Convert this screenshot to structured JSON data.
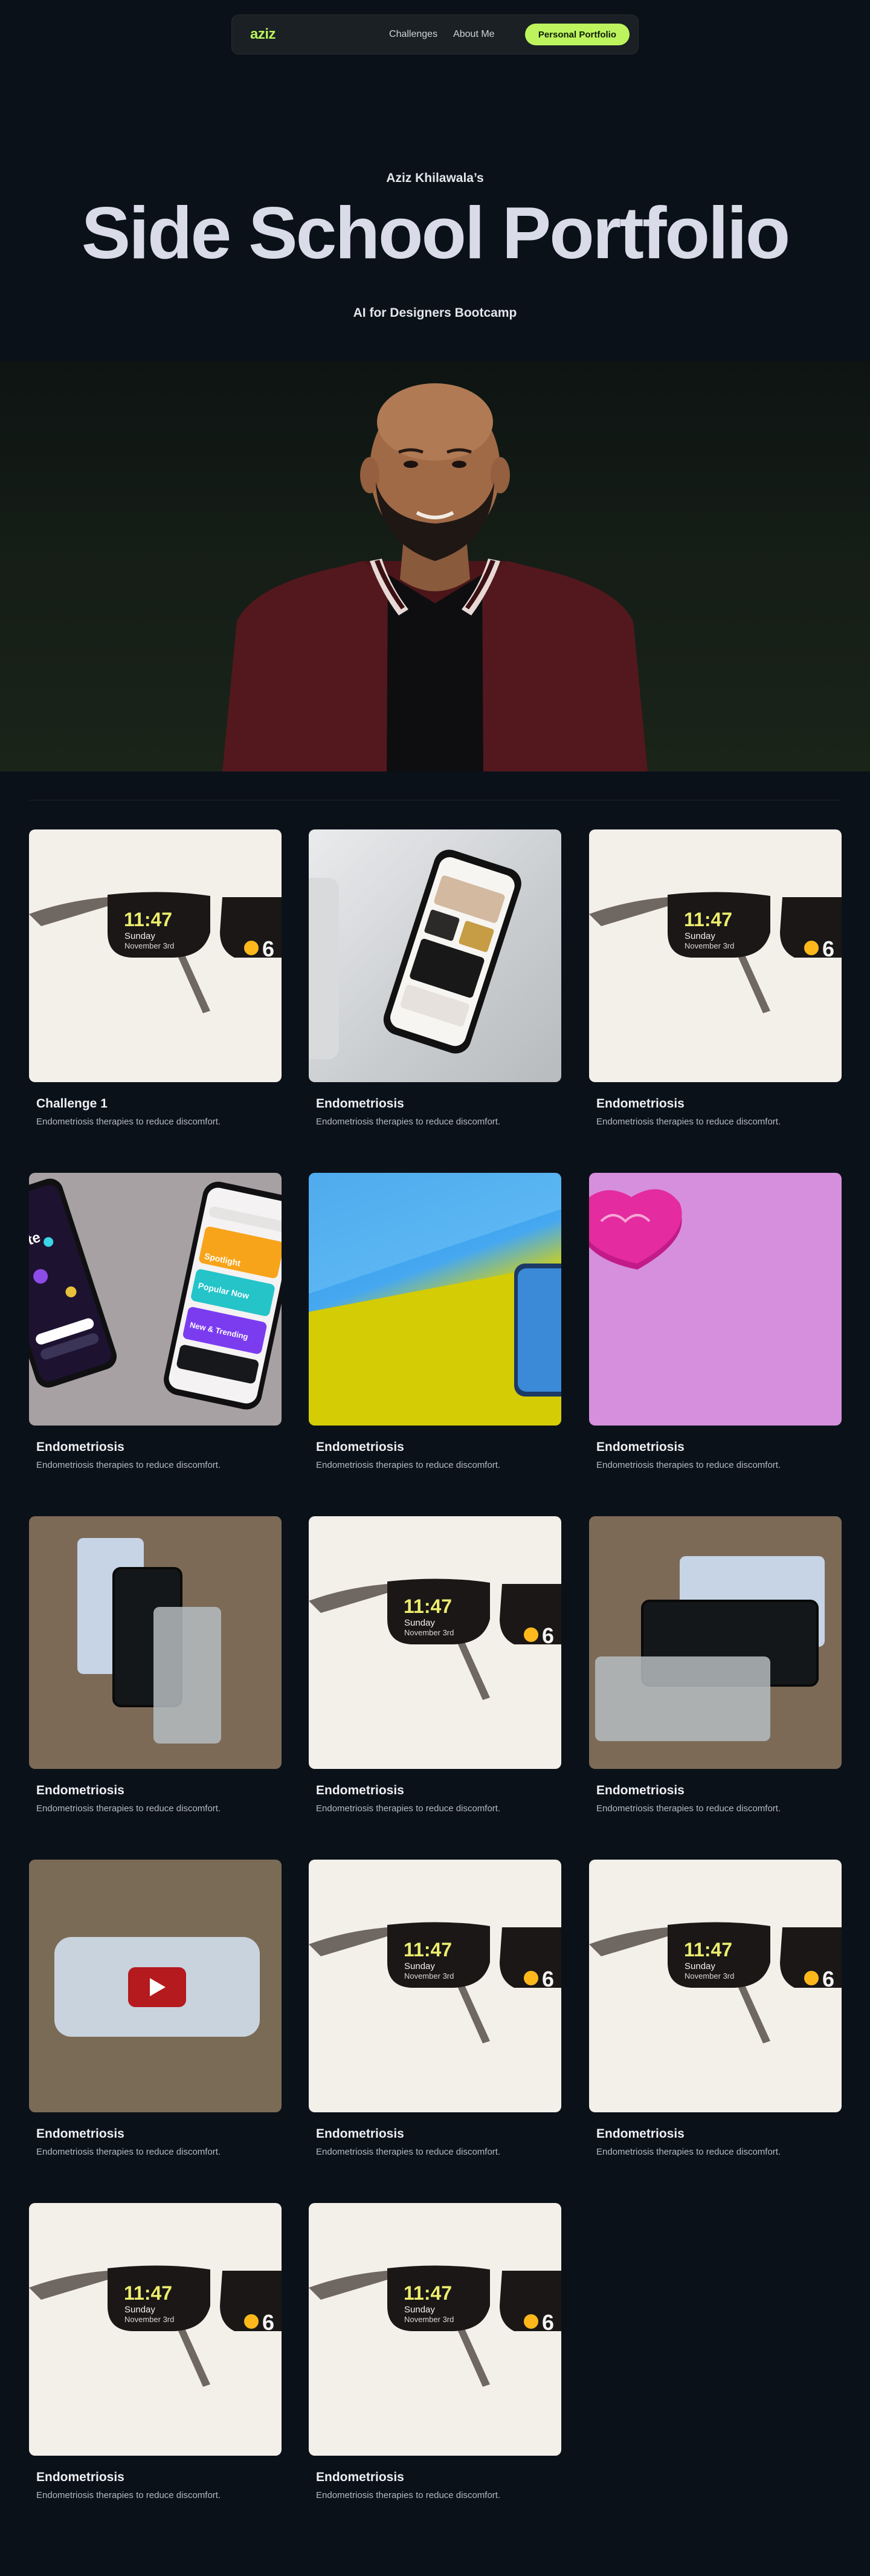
{
  "nav": {
    "logo": "aziz",
    "links": [
      "Challenges",
      "About Me"
    ],
    "cta": "Personal Portfolio"
  },
  "hero": {
    "kicker": "Aziz Khilawala’s",
    "title": "Side School Portfolio",
    "subtitle": "AI for Designers Bootcamp"
  },
  "glasses": {
    "time": "11:47",
    "day": "Sunday",
    "date": "November 3rd",
    "temp": "6"
  },
  "phone_labels": {
    "brand": "byte",
    "spotlight": "Spotlight",
    "popular": "Popular Now",
    "new": "New & Trending"
  },
  "cards": [
    {
      "title": "Challenge 1",
      "desc": "Endometriosis therapies to reduce discomfort."
    },
    {
      "title": "Endometriosis",
      "desc": "Endometriosis therapies to reduce discomfort."
    },
    {
      "title": "Endometriosis",
      "desc": "Endometriosis therapies to reduce discomfort."
    },
    {
      "title": "Endometriosis",
      "desc": "Endometriosis therapies to reduce discomfort."
    },
    {
      "title": "Endometriosis",
      "desc": "Endometriosis therapies to reduce discomfort."
    },
    {
      "title": "Endometriosis",
      "desc": "Endometriosis therapies to reduce discomfort."
    },
    {
      "title": "Endometriosis",
      "desc": "Endometriosis therapies to reduce discomfort."
    },
    {
      "title": "Endometriosis",
      "desc": "Endometriosis therapies to reduce discomfort."
    },
    {
      "title": "Endometriosis",
      "desc": "Endometriosis therapies to reduce discomfort."
    },
    {
      "title": "Endometriosis",
      "desc": "Endometriosis therapies to reduce discomfort."
    },
    {
      "title": "Endometriosis",
      "desc": "Endometriosis therapies to reduce discomfort."
    },
    {
      "title": "Endometriosis",
      "desc": "Endometriosis therapies to reduce discomfort."
    },
    {
      "title": "Endometriosis",
      "desc": "Endometriosis therapies to reduce discomfort."
    },
    {
      "title": "Endometriosis",
      "desc": "Endometriosis therapies to reduce discomfort."
    }
  ],
  "colors": {
    "background": "#0b1119",
    "accent": "#bdf45e",
    "logo": "#b8f25b"
  }
}
